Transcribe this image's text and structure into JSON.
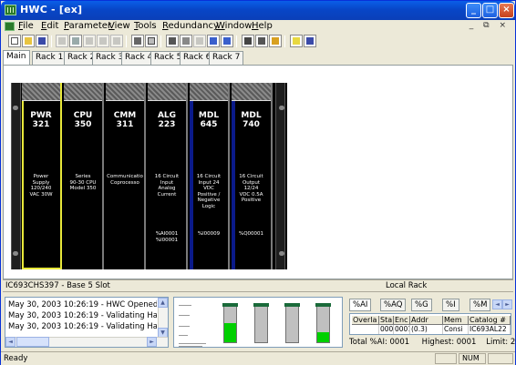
{
  "window": {
    "title": "HWC - [ex]",
    "min_glyph": "_",
    "max_glyph": "□",
    "close_glyph": "×"
  },
  "menu": [
    "File",
    "Edit",
    "Parameter",
    "View",
    "Tools",
    "Redundancy",
    "Window",
    "Help"
  ],
  "mdi_controls": "_ ⧉ ×",
  "toolbar_icons": [
    "new-icon",
    "open-icon",
    "save-icon",
    "cut-icon",
    "copy-icon",
    "paste-icon",
    "paste-special-icon",
    "delete-icon",
    "print-icon",
    "print-preview-icon",
    "module-properties-icon",
    "configure-icon",
    "export-icon",
    "go-online-icon",
    "go-offline-icon",
    "reference-icon",
    "view-icon",
    "validate-icon",
    "help-icon",
    "context-help-icon"
  ],
  "tabs": [
    "Main",
    "Rack 1",
    "Rack 2",
    "Rack 3",
    "Rack 4",
    "Rack 5",
    "Rack 6",
    "Rack 7"
  ],
  "rack": {
    "modules": [
      {
        "name": "PWR\n321",
        "desc": "Power\nSupply\n120/240\nVAC 30W",
        "refs": ""
      },
      {
        "name": "CPU\n350",
        "desc": "Series\n90-30 CPU\nModel 350",
        "refs": ""
      },
      {
        "name": "CMM\n311",
        "desc": "Communicatio\nCoprocesso",
        "refs": ""
      },
      {
        "name": "ALG\n223",
        "desc": "16 Circuit\nInput\nAnalog\nCurrent",
        "refs": "%AI0001\n%I00001"
      },
      {
        "name": "MDL\n645",
        "desc": "16 Circuit\nInput 24\nVDC\nPositive /\nNegative\nLogic",
        "refs": "%I00009"
      },
      {
        "name": "MDL\n740",
        "desc": "16 Circuit\nOutput\n12/24\nVDC 0.5A\nPositive",
        "refs": "%Q00001"
      }
    ]
  },
  "rackinfo": {
    "left": "IC693CHS397 - Base 5 Slot",
    "right": "Local Rack"
  },
  "log": [
    "May 30, 2003 10:26:19 - HWC Opened",
    "May 30, 2003 10:26:19 - Validating Hardwa",
    "May 30, 2003 10:26:19 - Validating Hardwa"
  ],
  "meters": [
    {
      "fill": 0.52
    },
    {
      "fill": 0.0
    },
    {
      "fill": 0.0
    },
    {
      "fill": 0.28
    }
  ],
  "memory": {
    "tabs": [
      "%AI",
      "%AQ",
      "%G",
      "%I",
      "%M"
    ],
    "scroll_left": "◄",
    "scroll_right": "►",
    "headers": [
      "Overla",
      "Sta",
      "Enc",
      "Addr",
      "Mem",
      "Catalog #"
    ],
    "row": [
      "",
      "0001",
      "0001",
      "(0.3)",
      "Consi",
      "IC693AL22"
    ],
    "total_label": "Total %AI: 0001",
    "highest_label": "Highest: 0001",
    "limit_label": "Limit: 2048"
  },
  "status": {
    "text": "Ready",
    "num": "NUM"
  }
}
